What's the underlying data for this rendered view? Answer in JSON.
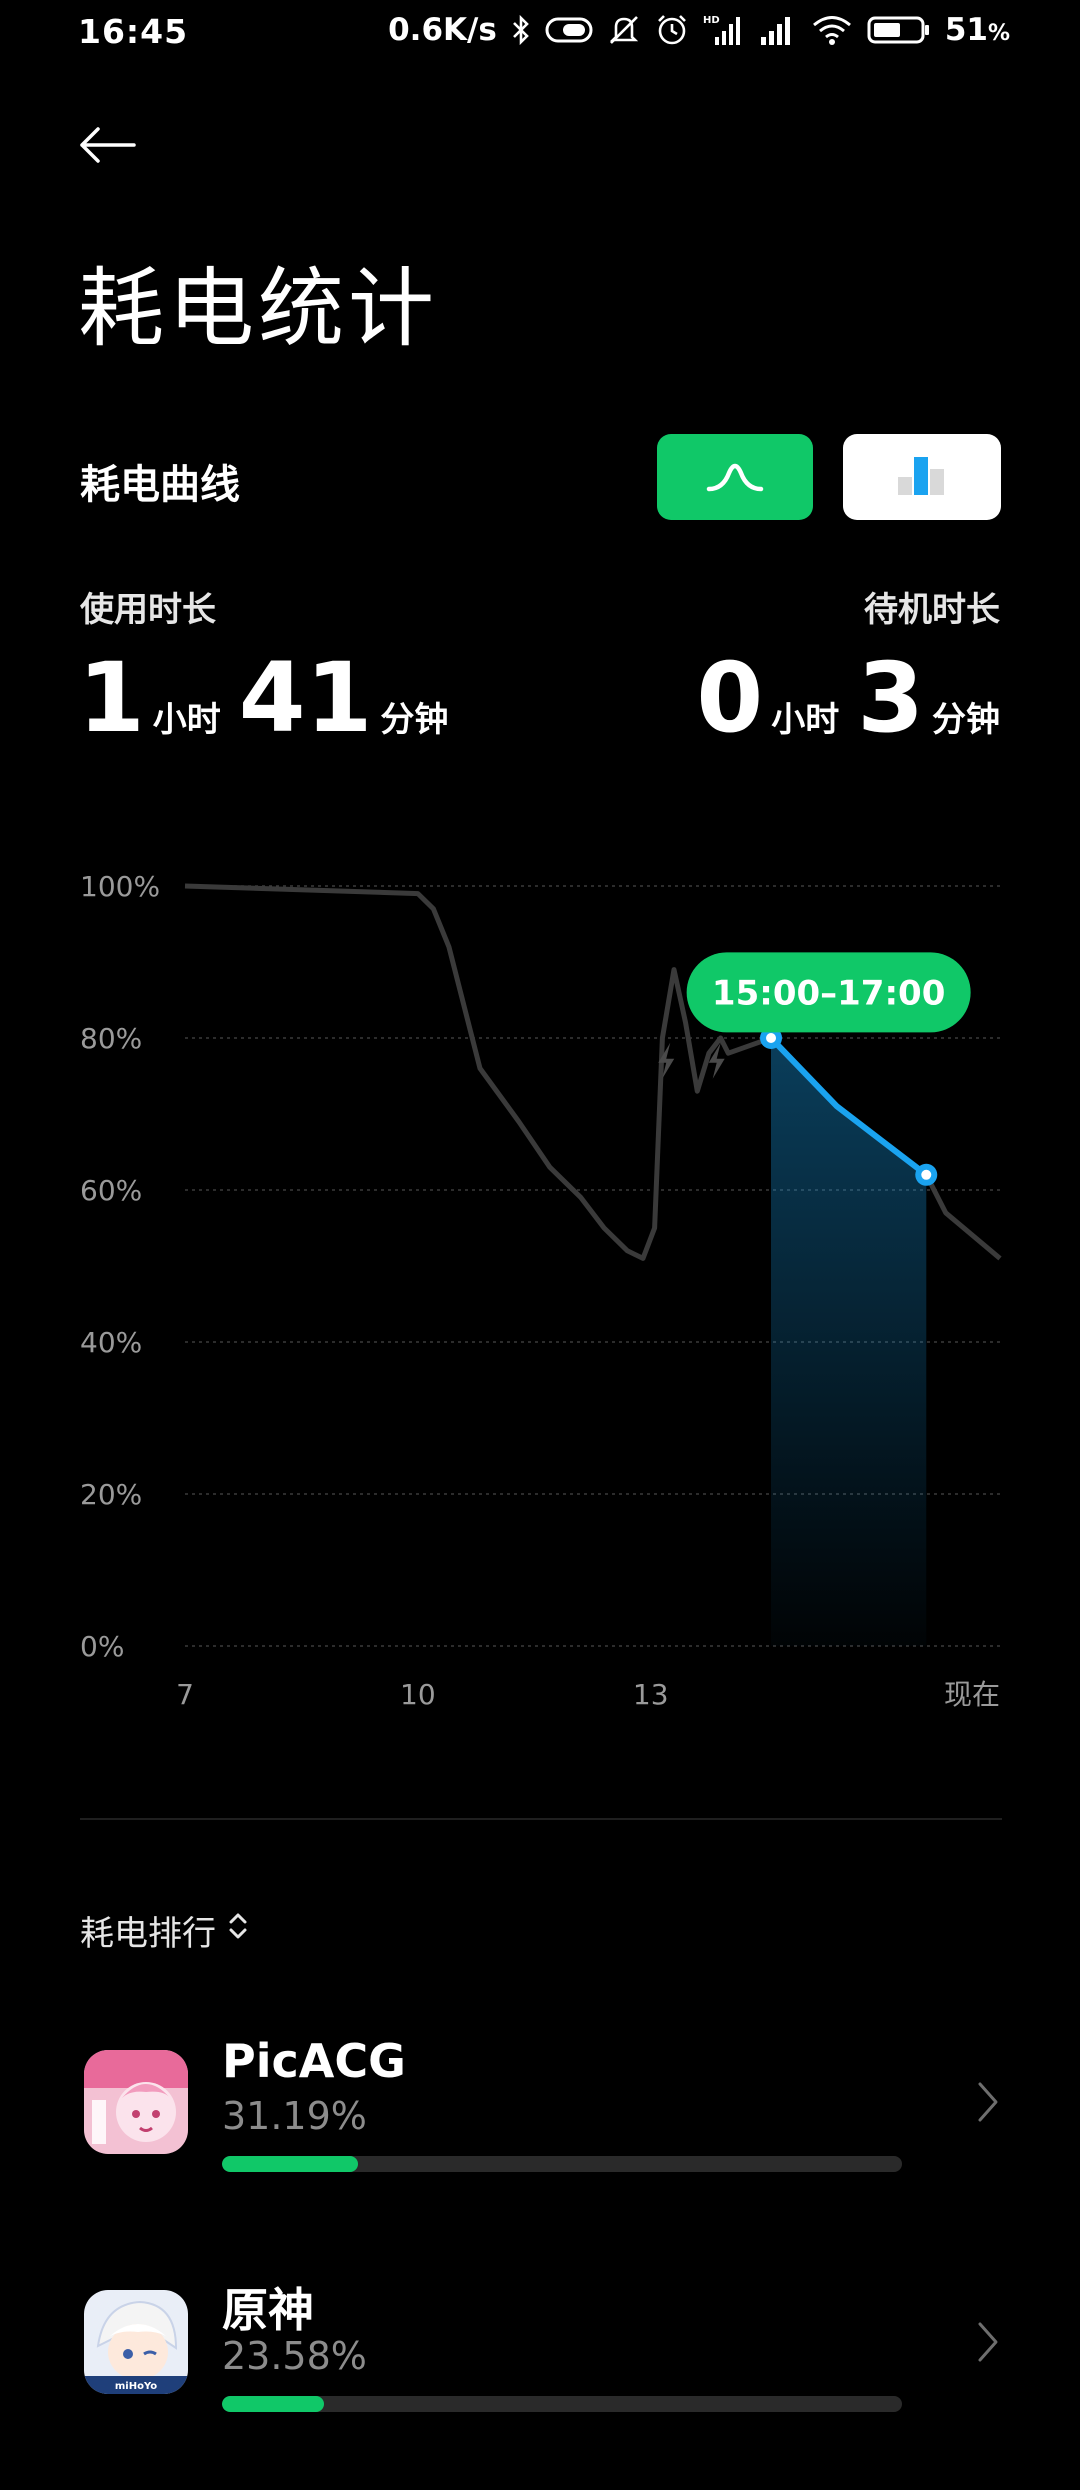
{
  "status_bar": {
    "time": "16:45",
    "net_speed": "0.6K/s",
    "battery_percent": "51",
    "battery_unit": "%",
    "icons": [
      "bluetooth-icon",
      "battery-saver-icon",
      "mute-icon",
      "alarm-icon",
      "hd-signal-icon",
      "signal-icon",
      "wifi-icon",
      "battery-icon"
    ]
  },
  "header": {
    "title": "耗电统计"
  },
  "chart_header": {
    "label": "耗电曲线",
    "toggle_curve_icon": "curve-icon",
    "toggle_bar_icon": "bar-chart-icon",
    "active_toggle": "curve"
  },
  "durations": {
    "use_label": "使用时长",
    "use_hours": "1",
    "use_minutes": "41",
    "standby_label": "待机时长",
    "standby_hours": "0",
    "standby_minutes": "3",
    "hour_unit": "小时",
    "minute_unit": "分钟"
  },
  "colors": {
    "accent_green": "#10c868",
    "highlight_blue": "#1aa3f0",
    "line_gray": "#3a3a3a"
  },
  "chart_data": {
    "type": "line",
    "ylabel": "",
    "xlabel": "",
    "ylim": [
      0,
      100
    ],
    "y_ticks": [
      "100%",
      "80%",
      "60%",
      "40%",
      "20%",
      "0%"
    ],
    "y_tick_values": [
      100,
      80,
      60,
      40,
      20,
      0
    ],
    "x_ticks": [
      "7",
      "10",
      "13",
      "现在"
    ],
    "x_tick_values": [
      7,
      10,
      13,
      17.5
    ],
    "grid": true,
    "series": [
      {
        "points": [
          [
            7,
            100
          ],
          [
            10,
            99
          ],
          [
            10.2,
            97
          ],
          [
            10.4,
            92
          ],
          [
            10.8,
            76
          ],
          [
            11.3,
            69
          ],
          [
            11.7,
            63
          ],
          [
            12.1,
            59
          ],
          [
            12.4,
            55
          ],
          [
            12.7,
            52
          ],
          [
            12.9,
            51
          ],
          [
            13.05,
            55
          ],
          [
            13.15,
            80
          ],
          [
            13.3,
            89
          ],
          [
            13.45,
            82
          ],
          [
            13.6,
            73
          ],
          [
            13.75,
            78
          ],
          [
            13.9,
            80
          ],
          [
            14.0,
            78
          ],
          [
            14.55,
            80
          ],
          [
            15.4,
            71
          ],
          [
            16.55,
            62
          ],
          [
            16.8,
            57
          ],
          [
            17.5,
            51
          ]
        ]
      }
    ],
    "highlight": {
      "label": "15:00–17:00",
      "points": [
        [
          14.55,
          80
        ],
        [
          15.4,
          71
        ],
        [
          16.55,
          62
        ]
      ]
    },
    "charging_markers": [
      13.2,
      13.85
    ]
  },
  "ranking": {
    "header": "耗电排行",
    "sort_icon": "sort-updown-icon",
    "apps": [
      {
        "name": "PicACG",
        "percent": "31.19%",
        "fraction": 0.2,
        "icon": "picacg-app-icon"
      },
      {
        "name": "原神",
        "percent": "23.58%",
        "fraction": 0.15,
        "icon": "genshin-app-icon",
        "icon_text": "miHoYo"
      }
    ]
  }
}
